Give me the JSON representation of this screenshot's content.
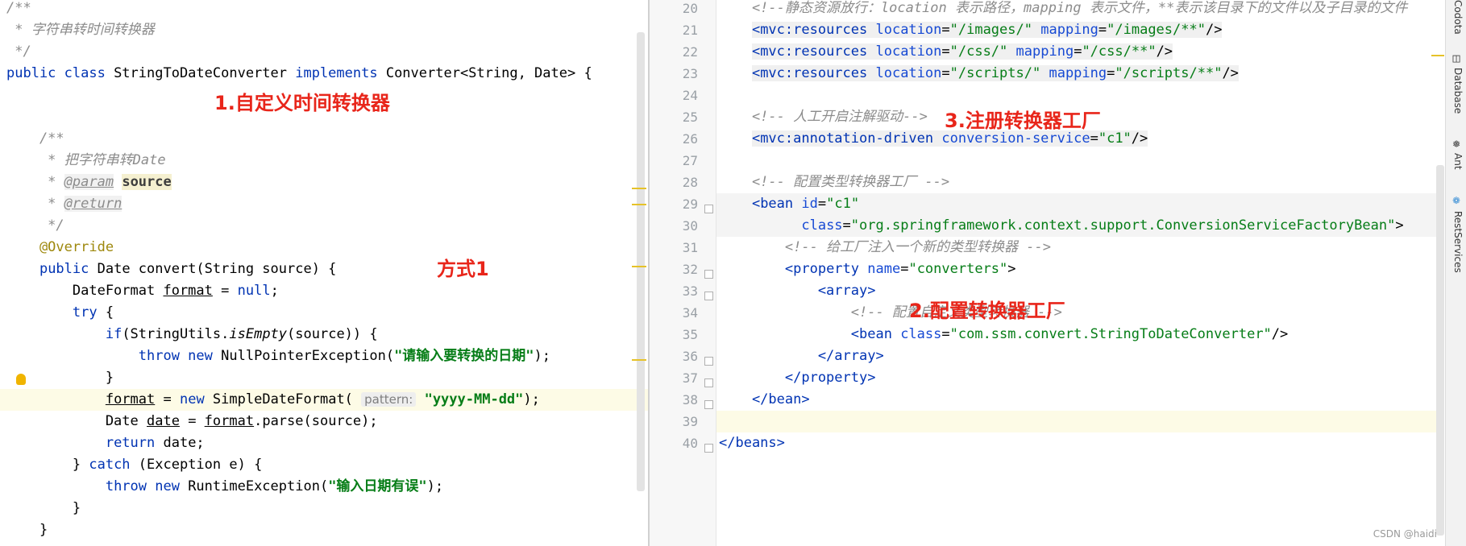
{
  "left_editor": {
    "lines": [
      "/**",
      " * 字符串转时间转换器",
      " */",
      "public class StringToDateConverter implements Converter<String, Date> {",
      "",
      "    /**",
      "     * 把字符串转Date",
      "     * @param source",
      "     * @return",
      "     */",
      "    @Override",
      "    public Date convert(String source) {",
      "        DateFormat format = null;",
      "        try {",
      "            if(StringUtils.isEmpty(source)) {",
      "                throw new NullPointerException(\"请输入要转换的日期\");",
      "            }",
      "            format = new SimpleDateFormat( pattern: \"yyyy-MM-dd\");",
      "            Date date = format.parse(source);",
      "            return date;",
      "        } catch (Exception e) {",
      "            throw new RuntimeException(\"输入日期有误\");",
      "        }",
      "    }"
    ],
    "hint_pattern": "pattern:"
  },
  "right_editor": {
    "line_numbers": [
      "20",
      "21",
      "22",
      "23",
      "24",
      "25",
      "26",
      "27",
      "28",
      "29",
      "30",
      "31",
      "32",
      "33",
      "34",
      "35",
      "36",
      "37",
      "38",
      "39",
      "40"
    ],
    "lines": [
      "    <!--静态资源放行：location 表示路径，mapping 表示文件，**表示该目录下的文件以及子目录的文件",
      "    <mvc:resources location=\"/images/\" mapping=\"/images/**\"/>",
      "    <mvc:resources location=\"/css/\" mapping=\"/css/**\"/>",
      "    <mvc:resources location=\"/scripts/\" mapping=\"/scripts/**\"/>",
      "",
      "    <!-- 人工开启注解驱动-->",
      "    <mvc:annotation-driven conversion-service=\"c1\"/>",
      "",
      "    <!-- 配置类型转换器工厂 -->",
      "    <bean id=\"c1\"",
      "          class=\"org.springframework.context.support.ConversionServiceFactoryBean\">",
      "        <!-- 给工厂注入一个新的类型转换器 -->",
      "        <property name=\"converters\">",
      "            <array>",
      "                <!-- 配置自定义类型转换器 -->",
      "                <bean class=\"com.ssm.convert.StringToDateConverter\"/>",
      "            </array>",
      "        </property>",
      "    </bean>",
      "",
      "</beans>"
    ]
  },
  "annotations": {
    "a1": "1.自定义时间转换器",
    "a_way": "方式1",
    "a2": "2.配置转换器工厂",
    "a3": "3.注册转换器工厂"
  },
  "tool_window": {
    "top_label": "Codota",
    "items": [
      "Database",
      "Ant",
      "RestServices"
    ]
  },
  "watermark": "CSDN @haidi"
}
